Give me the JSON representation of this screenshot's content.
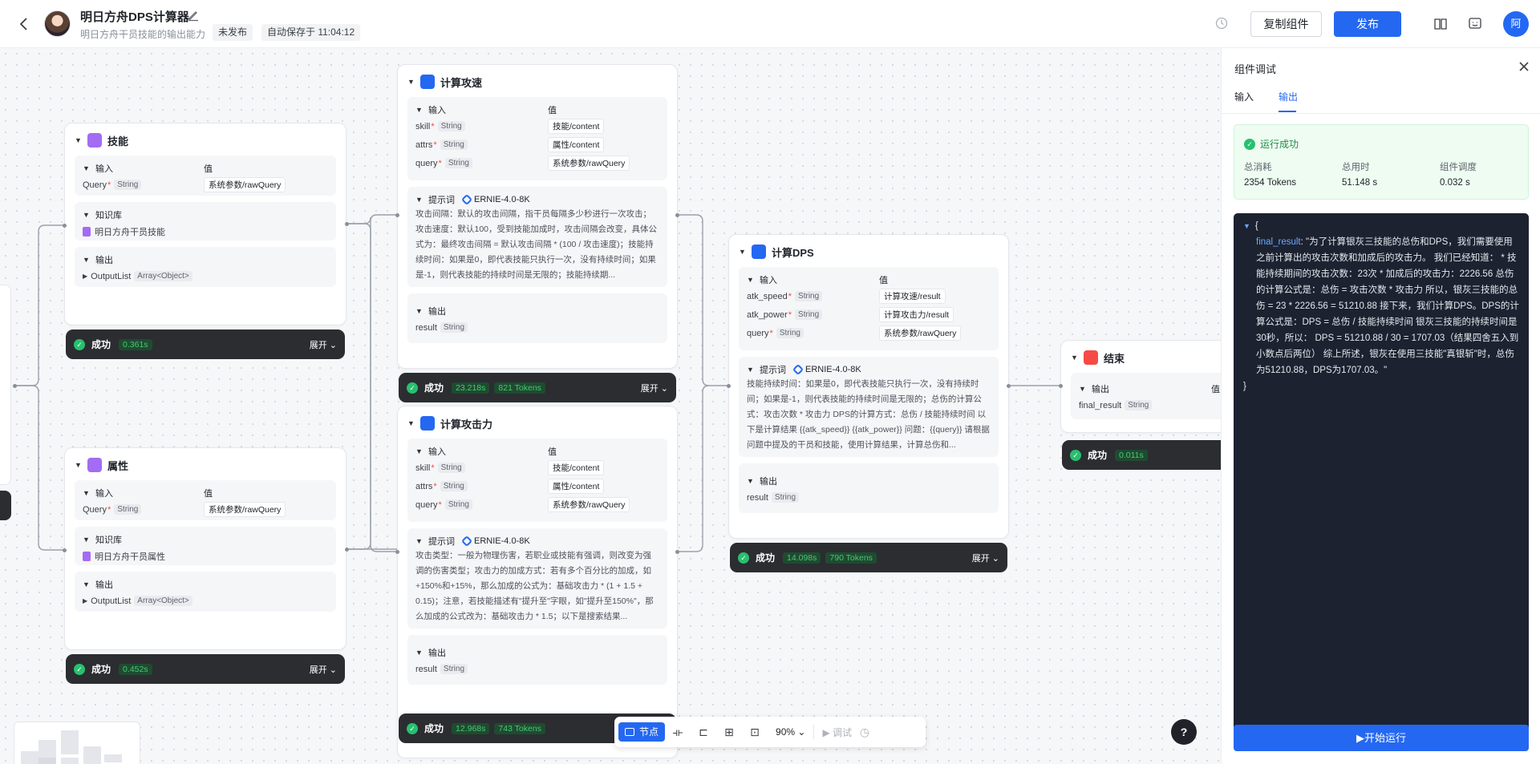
{
  "header": {
    "app_title": "明日方舟DPS计算器",
    "app_subtitle": "明日方舟干员技能的输出能力",
    "status_tag": "未发布",
    "autosave": "自动保存于 11:04:12",
    "copy_label": "复制组件",
    "publish_label": "发布",
    "user_initial": "阿"
  },
  "nodes": {
    "skill": {
      "title": "技能",
      "input_label": "输入",
      "value_label": "值",
      "params": [
        {
          "name": "Query",
          "type": "String",
          "value": "系统参数/rawQuery"
        }
      ],
      "kb_label": "知识库",
      "kb_item": "明日方舟干员技能",
      "output_label": "输出",
      "output_name": "OutputList",
      "output_type": "Array<Object>",
      "status": "成功",
      "time": "0.361s",
      "expand": "展开"
    },
    "attr": {
      "title": "属性",
      "input_label": "输入",
      "value_label": "值",
      "params": [
        {
          "name": "Query",
          "type": "String",
          "value": "系统参数/rawQuery"
        }
      ],
      "kb_label": "知识库",
      "kb_item": "明日方舟干员属性",
      "output_label": "输出",
      "output_name": "OutputList",
      "output_type": "Array<Object>",
      "status": "成功",
      "time": "0.452s",
      "expand": "展开"
    },
    "speed": {
      "title": "计算攻速",
      "input_label": "输入",
      "value_label": "值",
      "params": [
        {
          "name": "skill",
          "type": "String",
          "value": "技能/content"
        },
        {
          "name": "attrs",
          "type": "String",
          "value": "属性/content"
        },
        {
          "name": "query",
          "type": "String",
          "value": "系统参数/rawQuery"
        }
      ],
      "prompt_label": "提示词",
      "model": "ERNIE-4.0-8K",
      "prompt_text": "攻击间隔：默认的攻击间隔，指干员每隔多少秒进行一次攻击；攻击速度：默认100，受到技能加成时，攻击间隔会改变，具体公式为：最终攻击间隔 = 默认攻击间隔 * (100 / 攻击速度)；技能持续时间：如果是0，即代表技能只执行一次，没有持续时间；如果是-1，则代表技能的持续时间是无限的；技能持续期...",
      "output_label": "输出",
      "output_name": "result",
      "output_type": "String",
      "status": "成功",
      "time": "23.218s",
      "tokens": "821 Tokens",
      "expand": "展开"
    },
    "power": {
      "title": "计算攻击力",
      "input_label": "输入",
      "value_label": "值",
      "params": [
        {
          "name": "skill",
          "type": "String",
          "value": "技能/content"
        },
        {
          "name": "attrs",
          "type": "String",
          "value": "属性/content"
        },
        {
          "name": "query",
          "type": "String",
          "value": "系统参数/rawQuery"
        }
      ],
      "prompt_label": "提示词",
      "model": "ERNIE-4.0-8K",
      "prompt_text": "攻击类型：一般为物理伤害，若职业或技能有强调，则改变为强调的伤害类型；攻击力的加成方式：若有多个百分比的加成，如+150%和+15%，那么加成的公式为：基础攻击力 * (1 + 1.5 + 0.15)；注意，若技能描述有\"提升至\"字眼，如\"提升至150%\"，那么加成的公式改为：基础攻击力 * 1.5；以下是搜索结果...",
      "output_label": "输出",
      "output_name": "result",
      "output_type": "String",
      "status": "成功",
      "time": "12.968s",
      "tokens": "743 Tokens"
    },
    "dps": {
      "title": "计算DPS",
      "input_label": "输入",
      "value_label": "值",
      "params": [
        {
          "name": "atk_speed",
          "type": "String",
          "value": "计算攻速/result"
        },
        {
          "name": "atk_power",
          "type": "String",
          "value": "计算攻击力/result"
        },
        {
          "name": "query",
          "type": "String",
          "value": "系统参数/rawQuery"
        }
      ],
      "prompt_label": "提示词",
      "model": "ERNIE-4.0-8K",
      "prompt_text": "技能持续时间：如果是0，即代表技能只执行一次，没有持续时间；如果是-1，则代表技能的持续时间是无限的；总伤的计算公式：攻击次数 * 攻击力 DPS的计算方式：总伤 / 技能持续时间 以下是计算结果 {{atk_speed}} {{atk_power}} 问题：{{query}} 请根据问题中提及的干员和技能，使用计算结果，计算总伤和...",
      "output_label": "输出",
      "output_name": "result",
      "output_type": "String",
      "status": "成功",
      "time": "14.098s",
      "tokens": "790 Tokens",
      "expand": "展开"
    },
    "end": {
      "title": "结束",
      "output_label": "输出",
      "value_label": "值",
      "output_name": "final_result",
      "output_type": "String",
      "status": "成功",
      "time": "0.011s"
    }
  },
  "toolbar": {
    "node_label": "节点",
    "zoom": "90%",
    "debug_label": "调试"
  },
  "help": "?",
  "panel": {
    "title": "组件调试",
    "tabs": [
      "输入",
      "输出"
    ],
    "active_tab": "输出",
    "success_label": "运行成功",
    "stats": [
      {
        "label": "总消耗",
        "value": "2354 Tokens"
      },
      {
        "label": "总用时",
        "value": "51.148 s"
      },
      {
        "label": "组件调度",
        "value": "0.032 s"
      }
    ],
    "json_open": "{",
    "json_key": "final_result",
    "json_value": "\"为了计算银灰三技能的总伤和DPS，我们需要使用之前计算出的攻击次数和加成后的攻击力。 我们已经知道： * 技能持续期间的攻击次数：23次 * 加成后的攻击力：2226.56 总伤的计算公式是：总伤 = 攻击次数 * 攻击力 所以，银灰三技能的总伤 = 23 * 2226.56 = 51210.88 接下来，我们计算DPS。DPS的计算公式是：DPS = 总伤 / 技能持续时间 银灰三技能的持续时间是30秒，所以： DPS = 51210.88 / 30 = 1707.03（结果四舍五入到小数点后两位） 综上所述，银灰在使用三技能\"真银斩\"时，总伤为51210.88，DPS为1707.03。\"",
    "json_close": "}",
    "run_label": "▶开始运行"
  }
}
